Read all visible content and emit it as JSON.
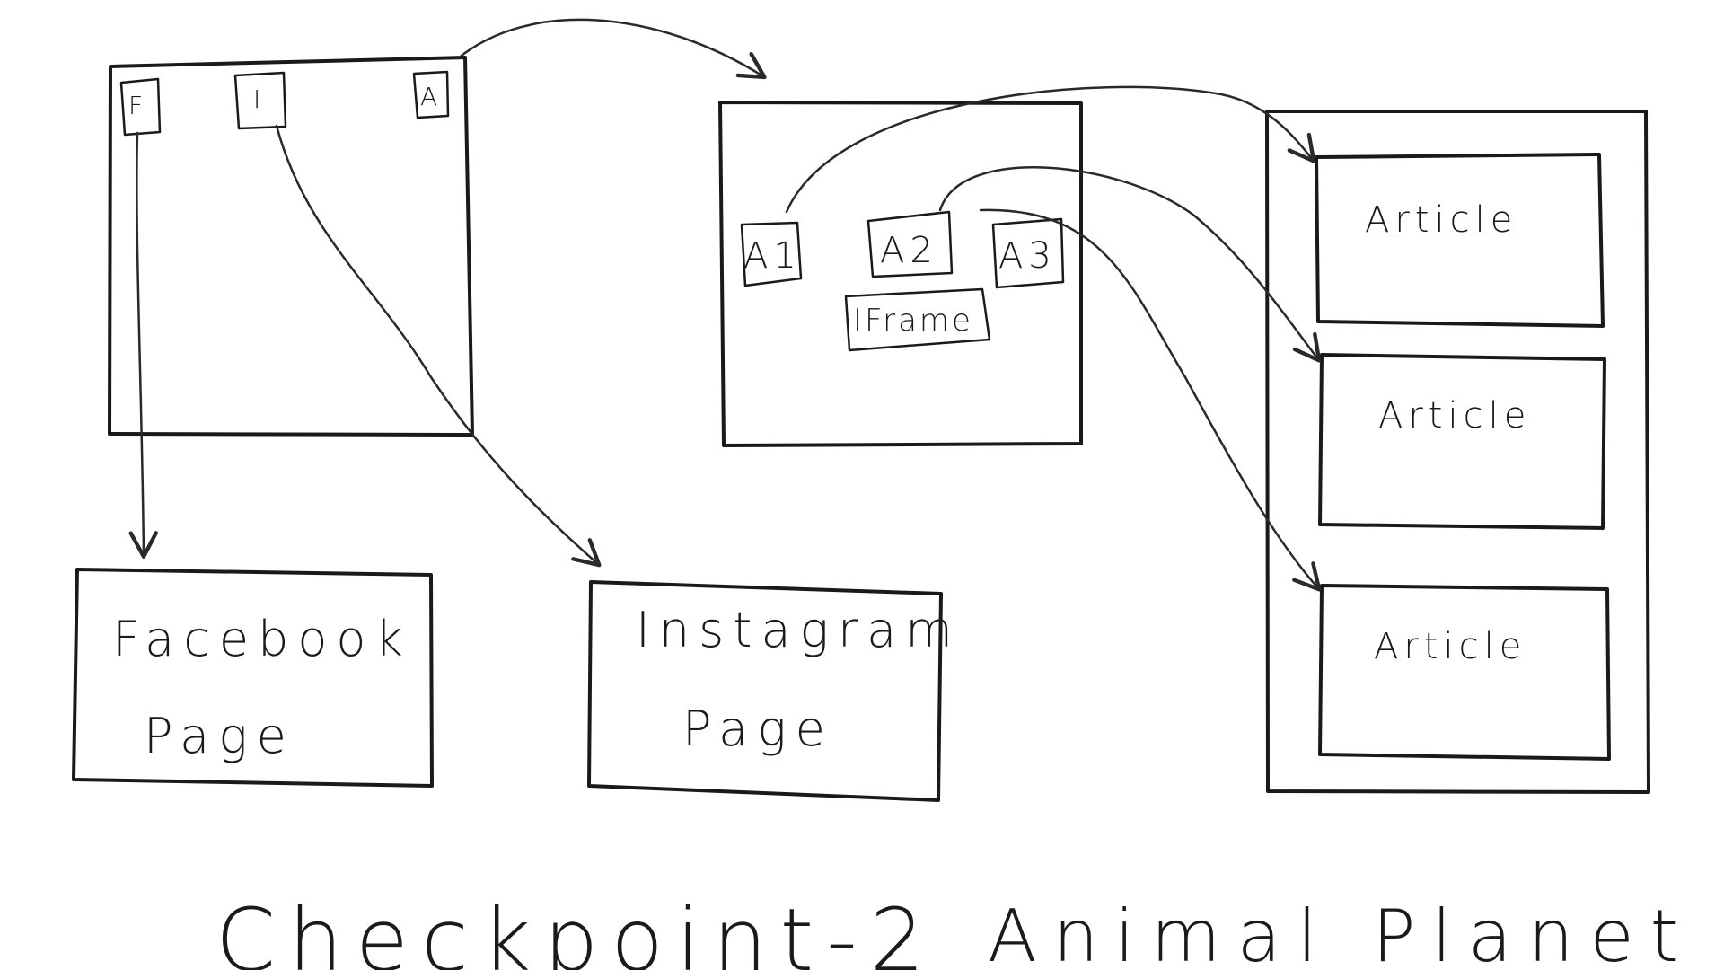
{
  "home_page": {
    "buttons": [
      {
        "label": "F"
      },
      {
        "label": "I"
      },
      {
        "label": "A"
      }
    ]
  },
  "facebook_page": {
    "line1": "Facebook",
    "line2": "Page"
  },
  "instagram_page": {
    "line1": "Instagram",
    "line2": "Page"
  },
  "animal_planet_page": {
    "buttons": [
      {
        "label": "A1"
      },
      {
        "label": "A2"
      },
      {
        "label": "A3"
      }
    ],
    "iframe_label": "IFrame",
    "caption": "Animal Planet Page"
  },
  "articles_page": {
    "articles": [
      {
        "label": "Article"
      },
      {
        "label": "Article"
      },
      {
        "label": "Article"
      }
    ]
  },
  "title": "Checkpoint-2",
  "colors": {
    "ink": "#1a1a1a",
    "background": "#ffffff"
  }
}
